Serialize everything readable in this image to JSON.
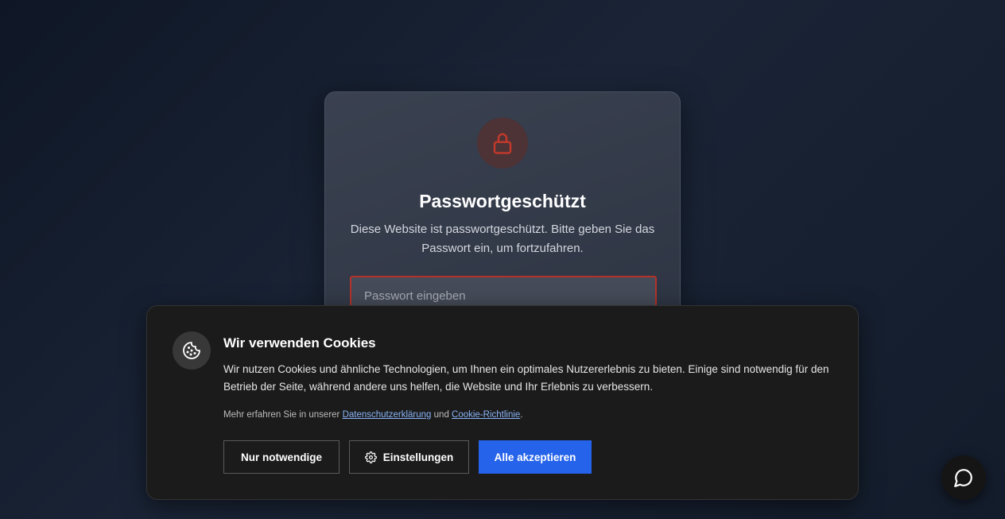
{
  "colors": {
    "accent_red": "#c0392b",
    "accept_blue": "#2563eb",
    "banner_bg": "#1b1b1b",
    "link": "#8ab4f8"
  },
  "password_card": {
    "icon": "lock-icon",
    "title": "Passwortgeschützt",
    "description": "Diese Website ist passwortgeschützt. Bitte geben Sie das Passwort ein, um fortzufahren.",
    "input_placeholder": "Passwort eingeben",
    "input_value": ""
  },
  "cookie_banner": {
    "icon": "cookie-icon",
    "title": "Wir verwenden Cookies",
    "text": "Wir nutzen Cookies und ähnliche Technologien, um Ihnen ein optimales Nutzererlebnis zu bieten. Einige sind notwendig für den Betrieb der Seite, während andere uns helfen, die Website und Ihr Erlebnis zu verbessern.",
    "more_prefix": "Mehr erfahren Sie in unserer ",
    "privacy_link": "Datenschutzerklärung",
    "more_and": " und ",
    "cookie_link": "Cookie-Richtlinie",
    "more_suffix": ".",
    "buttons": {
      "necessary": "Nur notwendige",
      "settings": "Einstellungen",
      "accept_all": "Alle akzeptieren"
    }
  },
  "chat_widget": {
    "icon": "chat-bubble-icon"
  }
}
